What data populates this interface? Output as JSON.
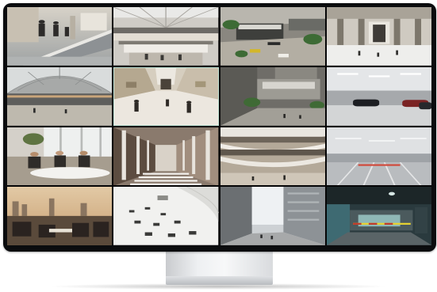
{
  "monitor": {
    "rows": 4,
    "columns": 4,
    "selected_tile": "mall-atrium-people"
  },
  "tiles": [
    {
      "id": "lobby-escalator",
      "scene": "lobby-escalator"
    },
    {
      "id": "mall-atrium-skylight",
      "scene": "mall-atrium-skylight"
    },
    {
      "id": "city-plaza-aerial",
      "scene": "city-plaza-aerial"
    },
    {
      "id": "grand-hall",
      "scene": "grand-hall"
    },
    {
      "id": "glass-roof-mall",
      "scene": "glass-roof-mall"
    },
    {
      "id": "mall-atrium-people",
      "scene": "mall-atrium-people"
    },
    {
      "id": "building-entrance",
      "scene": "building-entrance"
    },
    {
      "id": "parking-garage-cars",
      "scene": "parking-garage-cars"
    },
    {
      "id": "meeting-room",
      "scene": "meeting-room"
    },
    {
      "id": "colonnade-stairs",
      "scene": "colonnade-stairs"
    },
    {
      "id": "curved-mall-levels",
      "scene": "curved-mall-levels"
    },
    {
      "id": "parking-garage-empty",
      "scene": "parking-garage-empty"
    },
    {
      "id": "skyline-lounge",
      "scene": "skyline-lounge"
    },
    {
      "id": "white-hall-seating",
      "scene": "white-hall-seating"
    },
    {
      "id": "city-street",
      "scene": "city-street"
    },
    {
      "id": "parking-entrance-barrier",
      "scene": "parking-entrance-barrier"
    }
  ]
}
